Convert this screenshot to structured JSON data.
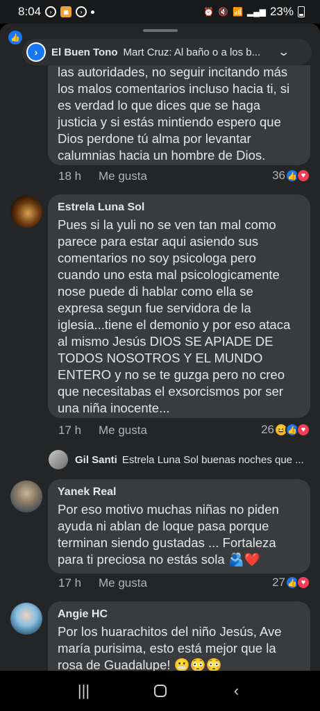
{
  "status_bar": {
    "time": "8:04",
    "battery": "23%"
  },
  "reply_header": {
    "author": "El Buen Tono",
    "preview": "Mart Cruz: Al baño o a los b..."
  },
  "comments": [
    {
      "author": "",
      "text": "las autoridades, no seguir incitando más los malos comentarios incluso hacia ti, si es verdad lo que dices que se haga justicia y si estás mintiendo espero que Dios perdone tú alma por levantar calumnias hacia un hombre de Dios.",
      "time": "18 h",
      "like_label": "Me gusta",
      "reaction_count": "36",
      "reactions": [
        "like-icon",
        "love-icon"
      ]
    },
    {
      "author": "Estrela Luna Sol",
      "text": "Pues si la yuli no se ven tan mal como parece para estar aqui asiendo sus comentarios no soy psicologa pero cuando uno esta mal psicologicamente nose puede di hablar como ella se expresa segun fue servidora de la iglesia...tiene el demonio y por eso ataca al mismo Jesús DIOS SE APIADE DE TODOS NOSOTROS Y EL MUNDO ENTERO y no se te guzga pero no creo que necesitabas el exsorcismos por ser una niña inocente...",
      "time": "17 h",
      "like_label": "Me gusta",
      "reaction_count": "26",
      "reactions": [
        "haha-icon",
        "like-icon",
        "love-icon"
      ]
    },
    {
      "author": "Yanek Real",
      "text": "Por eso motivo muchas niñas no piden ayuda ni ablan de loque pasa porque terminan siendo gustadas ... Fortaleza para ti preciosa no estás sola 🫂❤️",
      "time": "17 h",
      "like_label": "Me gusta",
      "reaction_count": "27",
      "reactions": [
        "like-icon",
        "love-icon"
      ]
    },
    {
      "author": "Angie HC",
      "text": "Por los huarachitos del niño Jesús, Ave maría purisima, esto está mejor que la rosa de Guadalupe! 😬😳😳"
    }
  ],
  "nested_reply": {
    "author": "Gil Santi",
    "preview": "Estrela Luna Sol buenas noches que ..."
  },
  "colors": {
    "background": "#242526",
    "bubble": "#3a3b3c",
    "like_blue": "#1877f2",
    "love_red": "#f33e58"
  }
}
